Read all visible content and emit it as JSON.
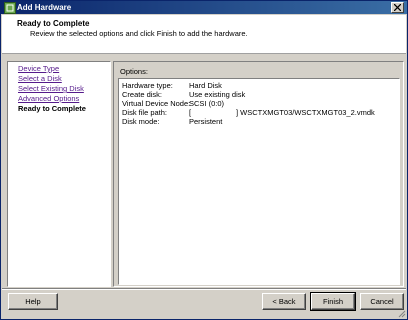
{
  "window": {
    "title": "Add Hardware"
  },
  "header": {
    "title": "Ready to Complete",
    "subtitle": "Review the selected options and click Finish to add the hardware."
  },
  "steps": [
    {
      "label": "Device Type"
    },
    {
      "label": "Select a Disk"
    },
    {
      "label": "Select Existing Disk"
    },
    {
      "label": "Advanced Options"
    },
    {
      "label": "Ready to Complete"
    }
  ],
  "options": {
    "label": "Options:",
    "rows": [
      {
        "key": "Hardware type:",
        "value": "Hard Disk"
      },
      {
        "key": "Create disk:",
        "value": "Use existing disk"
      },
      {
        "key": "Virtual Device Node:",
        "value": "SCSI (0:0)"
      },
      {
        "key": "Disk file path:",
        "value_a": "[",
        "value_b": "] WSCTXMGT03/WSCTXMGT03_2.vmdk"
      },
      {
        "key": "Disk mode:",
        "value": "Persistent"
      }
    ]
  },
  "buttons": {
    "help": "Help",
    "back": "< Back",
    "finish": "Finish",
    "cancel": "Cancel"
  },
  "colors": {
    "title_bar": "#0a246a",
    "link": "#551a8b",
    "face": "#d4d0c8"
  }
}
